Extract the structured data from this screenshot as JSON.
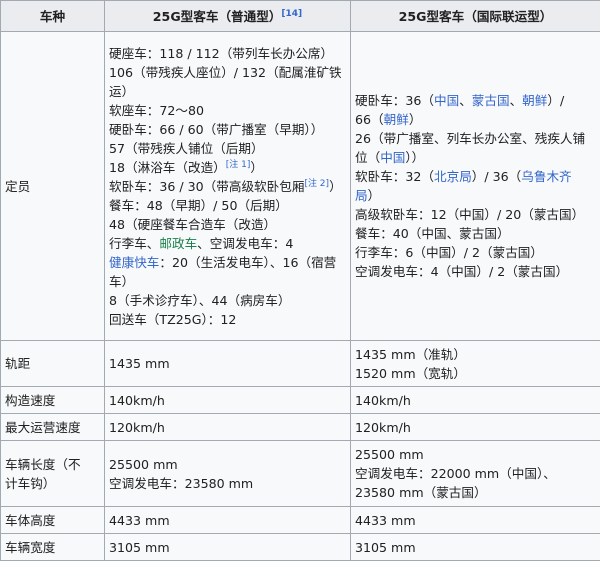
{
  "header": {
    "col_type": "车种",
    "col_normal": "25G型客车（普通型）",
    "col_normal_ref": "[14]",
    "col_intl": "25G型客车（国际联运型）"
  },
  "capacity": {
    "label": "定员",
    "normal": {
      "l1": "硬座车：118 / 112（带列车长办公席）",
      "l2": "106（带残疾人座位）/ 132（配属淮矿铁",
      "l3": "运）",
      "l4": "软座车：72～80",
      "l5": "硬卧车：66 / 60（带广播室（早期））",
      "l6": "57（带残疾人铺位（后期）",
      "l7_pre": "18（淋浴车（改造）",
      "l7_note": "[注 1]",
      "l7_post": "）",
      "l8_pre": "软卧车：36 / 30（带高级软卧包厢",
      "l8_note": "[注 2]",
      "l8_post": "）",
      "l9": "餐车：48（早期）/ 50（后期）",
      "l10": "48（硬座餐车合造车（改造）",
      "l11_pre": "行李车、",
      "l11_link": "邮政车",
      "l11_post": "、空调发电车：4",
      "l12_link": "健康快车",
      "l12_post": "：20（生活发电车）、16（宿营",
      "l13": "车）",
      "l14": "8（手术诊疗车）、44（病房车）",
      "l15": "回送车（TZ25G）：12"
    },
    "intl": {
      "l1_pre": "硬卧车：36（",
      "l1_l1": "中国",
      "l1_sep1": "、",
      "l1_l2": "蒙古国",
      "l1_sep2": "、",
      "l1_l3": "朝鲜",
      "l1_post": "）/",
      "l2_pre": "66（",
      "l2_link": "朝鲜",
      "l2_post": "）",
      "l3": "26（带广播室、列车长办公室、残疾人铺",
      "l4_pre": "位（",
      "l4_link": "中国",
      "l4_post": "））",
      "l5_pre": "软卧车：32（",
      "l5_l1": "北京局",
      "l5_mid": "）/ 36（",
      "l5_l2": "乌鲁木齐",
      "l6_link": "局",
      "l6_post": "）",
      "l7": "高级软卧车：12（中国）/ 20（蒙古国）",
      "l8": "餐车：40（中国、蒙古国）",
      "l9": "行李车：6（中国）/ 2（蒙古国）",
      "l10": "空调发电车：4（中国）/ 2（蒙古国）"
    }
  },
  "gauge": {
    "label": "轨距",
    "normal": "1435 mm",
    "intl_l1": "1435 mm（准轨）",
    "intl_l2": "1520 mm（宽轨）"
  },
  "design_speed": {
    "label": "构造速度",
    "normal": "140km/h",
    "intl": "140km/h"
  },
  "max_speed": {
    "label": "最大运营速度",
    "normal": "120km/h",
    "intl": "120km/h"
  },
  "length": {
    "label_l1": "车辆长度（不",
    "label_l2": "计车钩）",
    "normal_l1": "25500 mm",
    "normal_l2": "空调发电车：23580 mm",
    "intl_l1": "25500 mm",
    "intl_l2": "空调发电车：22000 mm（中国）、",
    "intl_l3": "23580 mm（蒙古国）"
  },
  "height": {
    "label": "车体高度",
    "normal": "4433 mm",
    "intl": "4433 mm"
  },
  "width": {
    "label": "车辆宽度",
    "normal": "3105 mm",
    "intl": "3105 mm"
  },
  "colors": {
    "border": "#a2a9b1",
    "header_bg": "#eaecf0",
    "cell_bg": "#f8f9fa",
    "link": "#3366cc",
    "link_green": "#1a7f4a"
  }
}
